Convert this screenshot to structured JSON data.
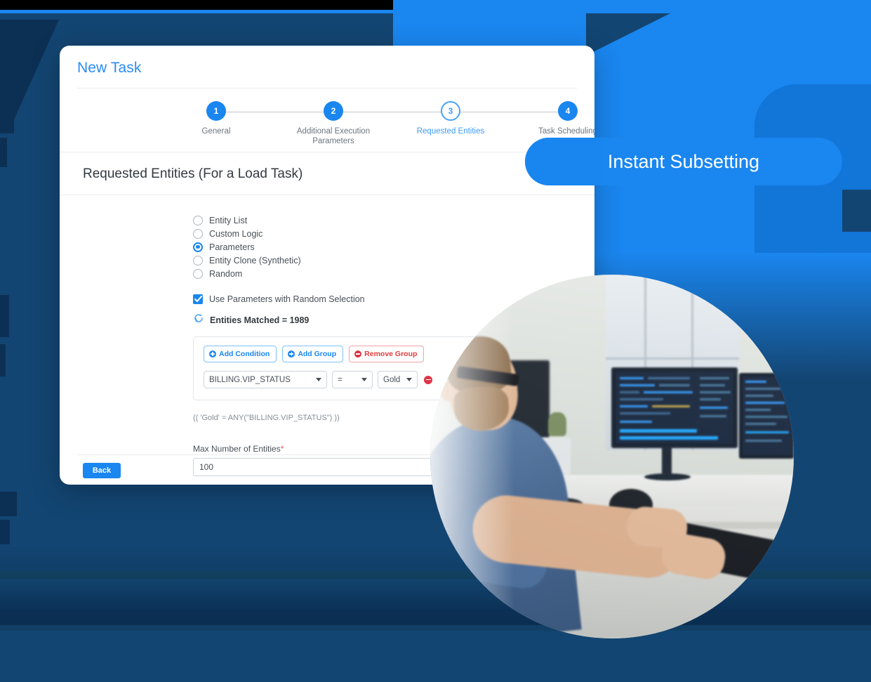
{
  "background": {
    "navy": "#134572",
    "accent_blue": "#1a86ef",
    "dark_navy": "#0c3054"
  },
  "card": {
    "title": "New Task",
    "stepper": [
      {
        "number": "1",
        "label": "General",
        "state": "done"
      },
      {
        "number": "2",
        "label": "Additional Execution Parameters",
        "state": "done"
      },
      {
        "number": "3",
        "label": "Requested Entities",
        "state": "active"
      },
      {
        "number": "4",
        "label": "Task Scheduling",
        "state": "done"
      }
    ],
    "section_title": "Requested Entities (For a Load Task)",
    "radio_options": [
      {
        "label": "Entity List",
        "selected": false
      },
      {
        "label": "Custom Logic",
        "selected": false
      },
      {
        "label": "Parameters",
        "selected": true
      },
      {
        "label": "Entity Clone (Synthetic)",
        "selected": false
      },
      {
        "label": "Random",
        "selected": false
      }
    ],
    "random_selection": {
      "label": "Use Parameters with Random Selection",
      "checked": true
    },
    "entities_matched": "Entities Matched = 1989",
    "group_buttons": [
      {
        "label": "Add Condition",
        "icon": "plus-circle-icon",
        "style": "blue"
      },
      {
        "label": "Add Group",
        "icon": "plus-circle-icon",
        "style": "blue"
      },
      {
        "label": "Remove Group",
        "icon": "minus-circle-icon",
        "style": "red"
      }
    ],
    "condition": {
      "field": "BILLING.VIP_STATUS",
      "operator": "=",
      "value": "Gold"
    },
    "expression": "(( 'Gold' = ANY(\"BILLING.VIP_STATUS\") ))",
    "max_entities": {
      "label": "Max Number of Entities",
      "required_marker": "*",
      "value": "100"
    },
    "back_button": "Back"
  },
  "badge": {
    "text": "Instant Subsetting"
  }
}
